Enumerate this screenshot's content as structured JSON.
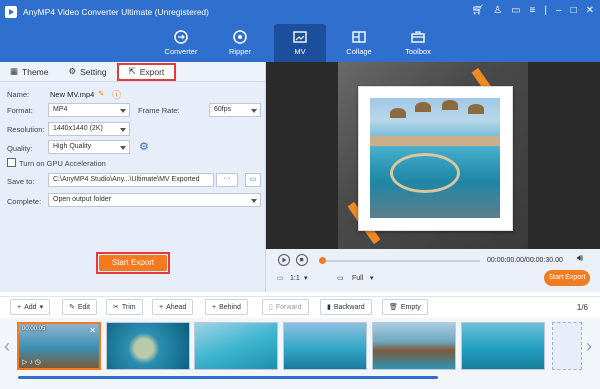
{
  "window": {
    "title": "AnyMP4 Video Converter Ultimate (Unregistered)"
  },
  "nav": [
    {
      "label": "Converter",
      "icon": "converter-icon"
    },
    {
      "label": "Ripper",
      "icon": "ripper-icon"
    },
    {
      "label": "MV",
      "icon": "mv-icon"
    },
    {
      "label": "Collage",
      "icon": "collage-icon"
    },
    {
      "label": "Toolbox",
      "icon": "toolbox-icon"
    }
  ],
  "tabs": {
    "theme": "Theme",
    "setting": "Setting",
    "export": "Export"
  },
  "form": {
    "name_label": "Name:",
    "name_value": "New MV.mp4",
    "format_label": "Format:",
    "format_value": "MP4",
    "frame_rate_label": "Frame Rate:",
    "frame_rate_value": "60fps",
    "resolution_label": "Resolution:",
    "resolution_value": "1440x1440 (2K)",
    "quality_label": "Quality:",
    "quality_value": "High Quality",
    "gpu_label": "Turn on GPU Acceleration",
    "save_to_label": "Save to:",
    "save_to_value": "C:\\AnyMP4 Studio\\Any...\\Ultimate\\MV Exported",
    "save_to_more": "···",
    "complete_label": "Complete:",
    "complete_value": "Open output folder"
  },
  "start_export": "Start Export",
  "player": {
    "time": "00:00:00.00/00:00:30.00",
    "ratio": "1:1",
    "zoom": "Full",
    "export": "Start Export"
  },
  "toolbar": {
    "add": "Add",
    "edit": "Edit",
    "trim": "Trim",
    "ahead": "Ahead",
    "behind": "Behind",
    "forward": "Forward",
    "backward": "Backward",
    "empty": "Empty",
    "page": "1/6"
  },
  "thumbnails": [
    "00:00:05",
    "",
    "",
    "",
    "",
    ""
  ],
  "colors": {
    "brand": "#2f6fce",
    "accent": "#f47a1f",
    "highlight": "#e23b3b"
  }
}
